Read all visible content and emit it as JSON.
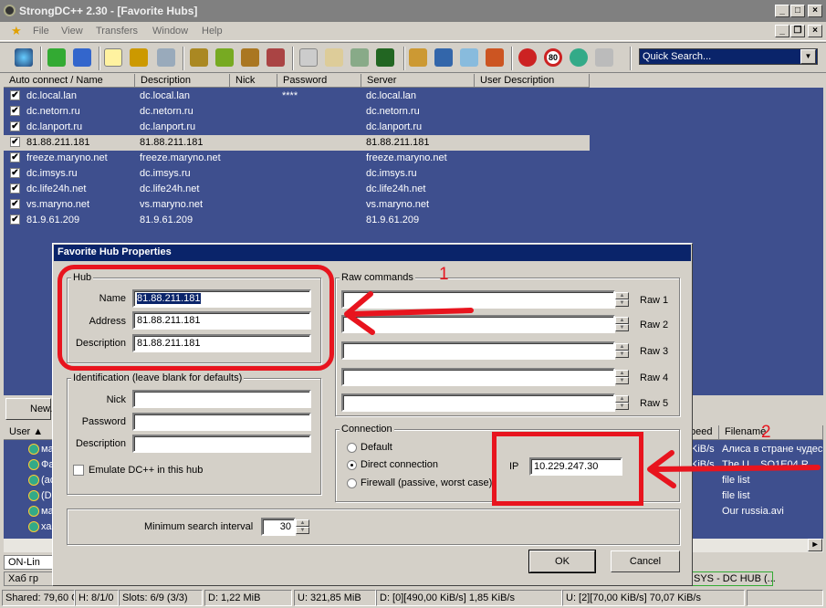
{
  "window": {
    "title": "StrongDC++ 2.30 - [Favorite Hubs]"
  },
  "menu": [
    "File",
    "View",
    "Transfers",
    "Window",
    "Help"
  ],
  "quick_search": {
    "value": "Quick Search..."
  },
  "hub_columns": [
    "Auto connect / Name",
    "Description",
    "Nick",
    "Password",
    "Server",
    "User Description"
  ],
  "hubs": [
    {
      "name": "dc.local.lan",
      "description": "dc.local.lan",
      "nick": "",
      "password": "****",
      "server": "dc.local.lan"
    },
    {
      "name": "dc.netorn.ru",
      "description": "dc.netorn.ru",
      "nick": "",
      "password": "",
      "server": "dc.netorn.ru"
    },
    {
      "name": "dc.lanport.ru",
      "description": "dc.lanport.ru",
      "nick": "",
      "password": "",
      "server": "dc.lanport.ru"
    },
    {
      "name": "81.88.211.181",
      "description": "81.88.211.181",
      "nick": "",
      "password": "",
      "server": "81.88.211.181"
    },
    {
      "name": "freeze.maryno.net",
      "description": "freeze.maryno.net",
      "nick": "",
      "password": "",
      "server": "freeze.maryno.net"
    },
    {
      "name": "dc.imsys.ru",
      "description": "dc.imsys.ru",
      "nick": "",
      "password": "",
      "server": "dc.imsys.ru"
    },
    {
      "name": "dc.life24h.net",
      "description": "dc.life24h.net",
      "nick": "",
      "password": "",
      "server": "dc.life24h.net"
    },
    {
      "name": "vs.maryno.net",
      "description": "vs.maryno.net",
      "nick": "",
      "password": "",
      "server": "vs.maryno.net"
    },
    {
      "name": "81.9.61.209",
      "description": "81.9.61.209",
      "nick": "",
      "password": "",
      "server": "81.9.61.209"
    }
  ],
  "new_button": "New...",
  "user_columns": {
    "user": "User",
    "speed": "peed",
    "filename": "Filename"
  },
  "users": [
    {
      "name": "ма",
      "speed": "KiB/s",
      "filename": "Алиса в стране чудес"
    },
    {
      "name": "Фа",
      "speed": "KiB/s",
      "filename": "The U...   SO1E04 R"
    },
    {
      "name": "(ac",
      "speed": "",
      "filename": "file list"
    },
    {
      "name": "(D'",
      "speed": "",
      "filename": "file list"
    },
    {
      "name": "ма",
      "speed": "",
      "filename": "Our russia.avi"
    },
    {
      "name": "хаб",
      "speed": "",
      "filename": ""
    }
  ],
  "tabs_row1": {
    "left": "ON-Lin"
  },
  "tabs_row2": {
    "left": "Хаб гр",
    "right": "SYS - DC HUB (..."
  },
  "status": {
    "shared": "Shared: 79,60 C",
    "hubs": "H: 8/1/0",
    "slots": "Slots: 6/9 (3/3)",
    "down_total": "D: 1,22 MiB",
    "up_total": "U: 321,85 MiB",
    "down_rate": "D: [0][490,00 KiB/s] 1,85 KiB/s",
    "up_rate": "U: [2][70,00 KiB/s] 70,07 KiB/s"
  },
  "dialog": {
    "title": "Favorite Hub Properties",
    "hub_group": "Hub",
    "name_label": "Name",
    "name_value": "81.88.211.181",
    "address_label": "Address",
    "address_value": "81.88.211.181",
    "description_label": "Description",
    "description_value": "81.88.211.181",
    "ident_group": "Identification (leave blank for defaults)",
    "nick_label": "Nick",
    "password_label": "Password",
    "ident_description_label": "Description",
    "emulate_label": "Emulate DC++ in this hub",
    "raw_group": "Raw commands",
    "raw_labels": [
      "Raw 1",
      "Raw 2",
      "Raw 3",
      "Raw 4",
      "Raw 5"
    ],
    "connection_group": "Connection",
    "conn_default": "Default",
    "conn_direct": "Direct connection",
    "conn_firewall": "Firewall (passive, worst case)",
    "ip_label": "IP",
    "ip_value": "10.229.247.30",
    "min_search_label": "Minimum search interval",
    "min_search_value": "30",
    "ok": "OK",
    "cancel": "Cancel"
  },
  "annotations": {
    "one": "1",
    "two": "2",
    "color": "#e8141e"
  }
}
